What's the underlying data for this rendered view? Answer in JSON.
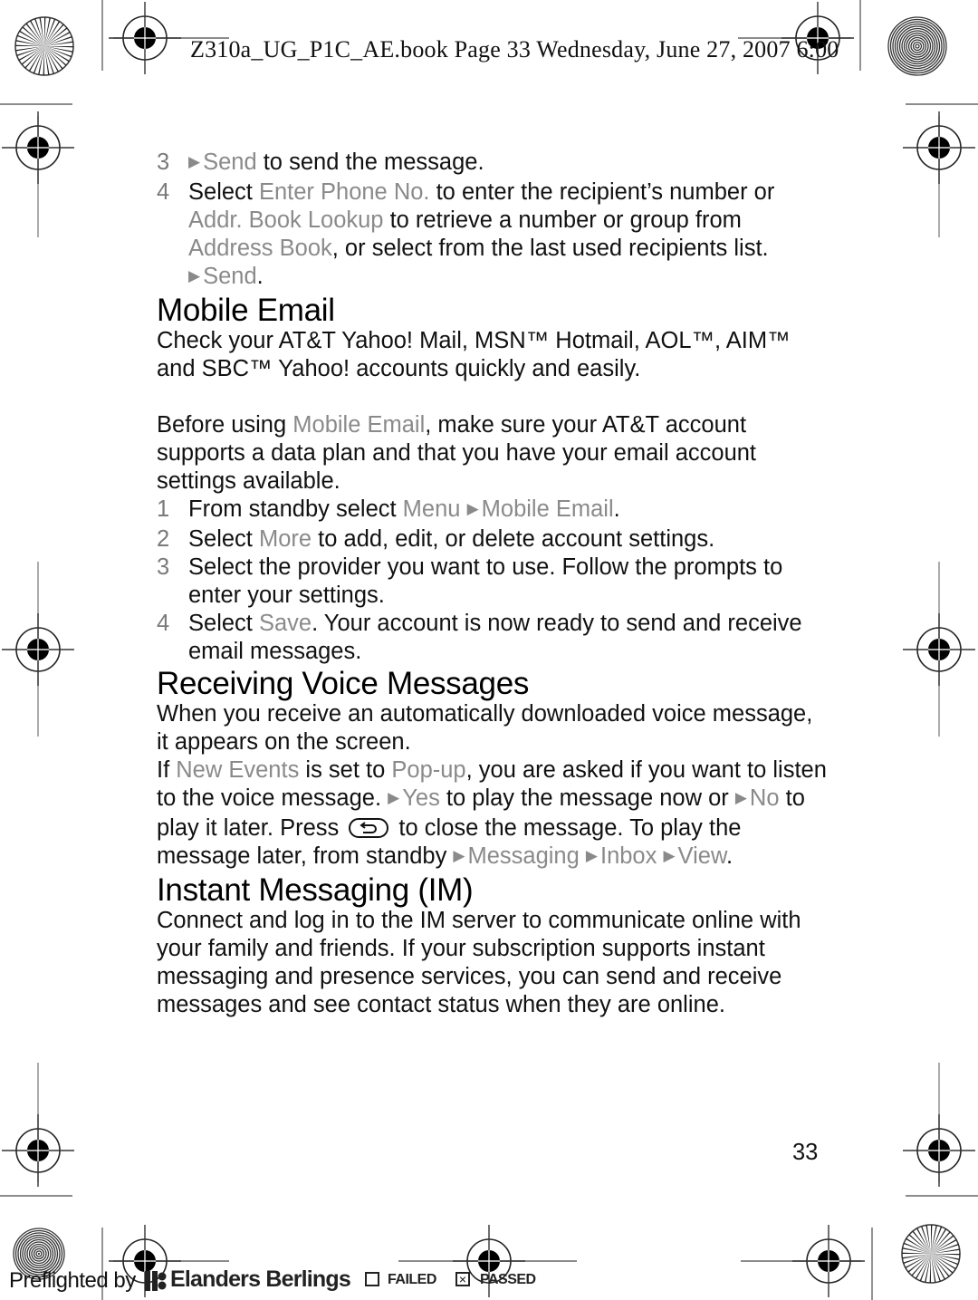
{
  "slug_line": "Z310a_UG_P1C_AE.book  Page 33  Wednesday, June 27, 2007  6:00",
  "intro_steps": [
    {
      "num": "3",
      "parts": [
        {
          "t": "arrow"
        },
        {
          "t": "hl",
          "v": "Send"
        },
        {
          "t": "txt",
          "v": " to send the message."
        }
      ]
    },
    {
      "num": "4",
      "parts": [
        {
          "t": "txt",
          "v": "Select "
        },
        {
          "t": "hl",
          "v": "Enter Phone No."
        },
        {
          "t": "txt",
          "v": " to enter the recipient’s number or "
        },
        {
          "t": "hl",
          "v": "Addr. Book Lookup"
        },
        {
          "t": "txt",
          "v": " to retrieve a number or group from "
        },
        {
          "t": "hl",
          "v": "Address Book"
        },
        {
          "t": "txt",
          "v": ", or select from the last used recipients list. "
        },
        {
          "t": "arrow"
        },
        {
          "t": "hl",
          "v": "Send"
        },
        {
          "t": "txt",
          "v": "."
        }
      ]
    }
  ],
  "sections": {
    "mobile_email": {
      "title": "Mobile Email",
      "intro": "Check your AT&T Yahoo! Mail, MSN™ Hotmail, AOL™, AIM™ and SBC™ Yahoo! accounts quickly and easily.",
      "before_parts": [
        {
          "t": "txt",
          "v": "Before using "
        },
        {
          "t": "hl",
          "v": "Mobile Email"
        },
        {
          "t": "txt",
          "v": ", make sure your AT&T account supports a data plan and that you have your email account settings available."
        }
      ],
      "steps": [
        {
          "num": "1",
          "parts": [
            {
              "t": "txt",
              "v": "From standby select "
            },
            {
              "t": "hl",
              "v": "Menu"
            },
            {
              "t": "txt",
              "v": " "
            },
            {
              "t": "arrow"
            },
            {
              "t": "hl",
              "v": "Mobile Email"
            },
            {
              "t": "txt",
              "v": "."
            }
          ]
        },
        {
          "num": "2",
          "parts": [
            {
              "t": "txt",
              "v": "Select "
            },
            {
              "t": "hl",
              "v": "More"
            },
            {
              "t": "txt",
              "v": " to add, edit, or delete account settings."
            }
          ]
        },
        {
          "num": "3",
          "parts": [
            {
              "t": "txt",
              "v": "Select the provider you want to use. Follow the prompts to enter your settings."
            }
          ]
        },
        {
          "num": "4",
          "parts": [
            {
              "t": "txt",
              "v": "Select "
            },
            {
              "t": "hl",
              "v": "Save"
            },
            {
              "t": "txt",
              "v": ". Your account is now ready to send and receive email messages."
            }
          ]
        }
      ]
    },
    "voice_messages": {
      "title": "Receiving Voice Messages",
      "intro": "When you receive an automatically downloaded voice message, it appears on the screen.",
      "body_parts": [
        {
          "t": "txt",
          "v": "If "
        },
        {
          "t": "hl",
          "v": "New Events"
        },
        {
          "t": "txt",
          "v": " is set to "
        },
        {
          "t": "hl",
          "v": "Pop-up"
        },
        {
          "t": "txt",
          "v": ", you are asked if you want to listen to the voice message. "
        },
        {
          "t": "arrow"
        },
        {
          "t": "hl",
          "v": "Yes"
        },
        {
          "t": "txt",
          "v": " to play the message now or "
        },
        {
          "t": "arrow"
        },
        {
          "t": "hl",
          "v": "No"
        },
        {
          "t": "txt",
          "v": " to play it later. Press "
        },
        {
          "t": "key",
          "v": "back-key-icon"
        },
        {
          "t": "txt",
          "v": " to close the message. To play the message later, from standby "
        },
        {
          "t": "arrow"
        },
        {
          "t": "hl",
          "v": "Messaging"
        },
        {
          "t": "txt",
          "v": " "
        },
        {
          "t": "arrow"
        },
        {
          "t": "hl",
          "v": "Inbox"
        },
        {
          "t": "txt",
          "v": " "
        },
        {
          "t": "arrow"
        },
        {
          "t": "hl",
          "v": "View"
        },
        {
          "t": "txt",
          "v": "."
        }
      ]
    },
    "instant_messaging": {
      "title": "Instant Messaging (IM)",
      "body": "Connect and log in to the IM server to communicate online with your family and friends. If your subscription supports instant messaging and presence services, you can send and receive messages and see contact status when they are online."
    }
  },
  "page_number": "33",
  "footer": {
    "preflighted_by": "Preflighted by",
    "brand": "Elanders Berlings",
    "failed_label": "FAILED",
    "passed_label": "PASSED",
    "failed_checked": false,
    "passed_checked": true,
    "check_mark": "×"
  },
  "colors": {
    "highlight": "#8a8a8a",
    "text": "#111111"
  }
}
